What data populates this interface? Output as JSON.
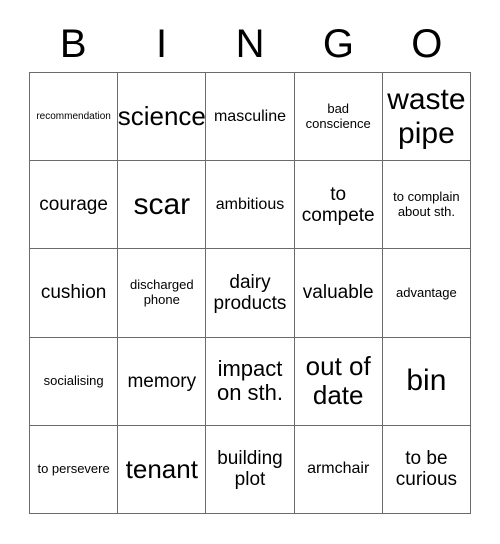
{
  "header": {
    "letters": [
      "B",
      "I",
      "N",
      "G",
      "O"
    ]
  },
  "grid": {
    "columns": 5,
    "rows": 5,
    "border_color": "#6b6b6b",
    "background_color": "#ffffff",
    "text_color": "#000000",
    "cells": [
      {
        "text": "recommendation",
        "size": "fs-xxs"
      },
      {
        "text": "science",
        "size": "fs-xl"
      },
      {
        "text": "masculine",
        "size": "fs-sm"
      },
      {
        "text": "bad conscience",
        "size": "fs-xs"
      },
      {
        "text": "waste pipe",
        "size": "fs-xxl"
      },
      {
        "text": "courage",
        "size": "fs-md"
      },
      {
        "text": "scar",
        "size": "fs-xxl"
      },
      {
        "text": "ambitious",
        "size": "fs-sm"
      },
      {
        "text": "to compete",
        "size": "fs-md"
      },
      {
        "text": "to complain about sth.",
        "size": "fs-xs"
      },
      {
        "text": "cushion",
        "size": "fs-md"
      },
      {
        "text": "discharged phone",
        "size": "fs-xs"
      },
      {
        "text": "dairy products",
        "size": "fs-md"
      },
      {
        "text": "valuable",
        "size": "fs-md"
      },
      {
        "text": "advantage",
        "size": "fs-xs"
      },
      {
        "text": "socialising",
        "size": "fs-xs"
      },
      {
        "text": "memory",
        "size": "fs-md"
      },
      {
        "text": "impact on sth.",
        "size": "fs-lg"
      },
      {
        "text": "out of date",
        "size": "fs-xl"
      },
      {
        "text": "bin",
        "size": "fs-xxl"
      },
      {
        "text": "to persevere",
        "size": "fs-xs"
      },
      {
        "text": "tenant",
        "size": "fs-xl"
      },
      {
        "text": "building plot",
        "size": "fs-md"
      },
      {
        "text": "armchair",
        "size": "fs-sm"
      },
      {
        "text": "to be curious",
        "size": "fs-md"
      }
    ]
  }
}
